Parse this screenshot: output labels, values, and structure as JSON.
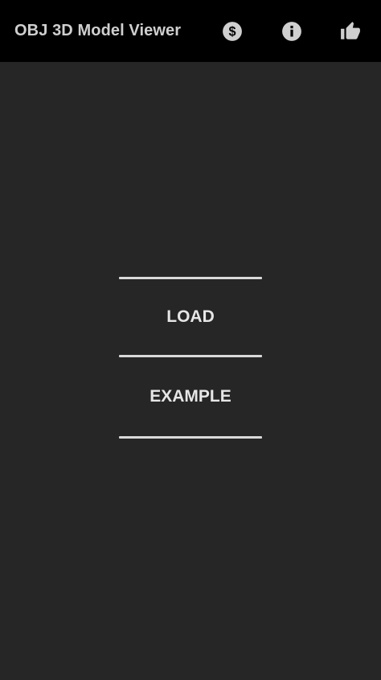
{
  "appbar": {
    "title": "OBJ 3D Model Viewer",
    "actions": [
      {
        "icon": "dollar-icon"
      },
      {
        "icon": "info-icon"
      },
      {
        "icon": "thumbs-up-icon"
      }
    ]
  },
  "main": {
    "load_label": "LOAD",
    "example_label": "EXAMPLE"
  },
  "colors": {
    "appbar_bg": "#000000",
    "content_bg": "#262626",
    "text": "#e6e6e6",
    "divider": "#d9d9d9"
  }
}
